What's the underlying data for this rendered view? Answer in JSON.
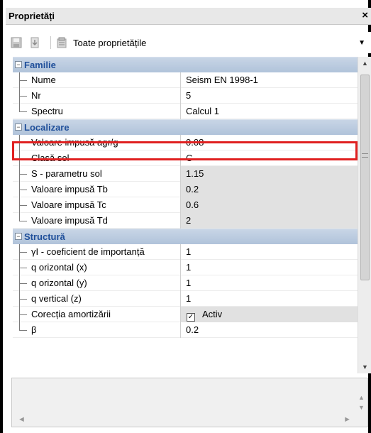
{
  "window": {
    "title": "Proprietăți",
    "close_label": "×"
  },
  "toolbar": {
    "view_label": "Toate proprietățile"
  },
  "categories": [
    {
      "name": "Familie",
      "properties": [
        {
          "name": "Nume",
          "value": "Seism EN 1998-1",
          "readonly": false
        },
        {
          "name": "Nr",
          "value": "5",
          "readonly": false
        },
        {
          "name": "Spectru",
          "value": "Calcul 1",
          "readonly": false
        }
      ]
    },
    {
      "name": "Localizare",
      "properties": [
        {
          "name": "Valoare impusă agr/g",
          "value": "0.08",
          "readonly": false
        },
        {
          "name": "Clasă sol",
          "value": "C",
          "readonly": false
        },
        {
          "name": "S - parametru sol",
          "value": "1.15",
          "readonly": true
        },
        {
          "name": "Valoare impusă Tb",
          "value": "0.2",
          "readonly": true
        },
        {
          "name": "Valoare impusă Tc",
          "value": "0.6",
          "readonly": true
        },
        {
          "name": "Valoare impusă Td",
          "value": "2",
          "readonly": true
        }
      ]
    },
    {
      "name": "Structură",
      "properties": [
        {
          "name": "γI - coeficient de importanță",
          "value": "1",
          "readonly": false
        },
        {
          "name": "q orizontal (x)",
          "value": "1",
          "readonly": false
        },
        {
          "name": "q orizontal (y)",
          "value": "1",
          "readonly": false
        },
        {
          "name": "q vertical (z)",
          "value": "1",
          "readonly": false
        },
        {
          "name": "Corecția amortizării",
          "value": "Activ",
          "readonly": true,
          "checkbox": true,
          "checked": true
        },
        {
          "name": "β",
          "value": "0.2",
          "readonly": false
        }
      ]
    }
  ],
  "highlight_color": "#e02020",
  "category_color": "#1f4f9a"
}
